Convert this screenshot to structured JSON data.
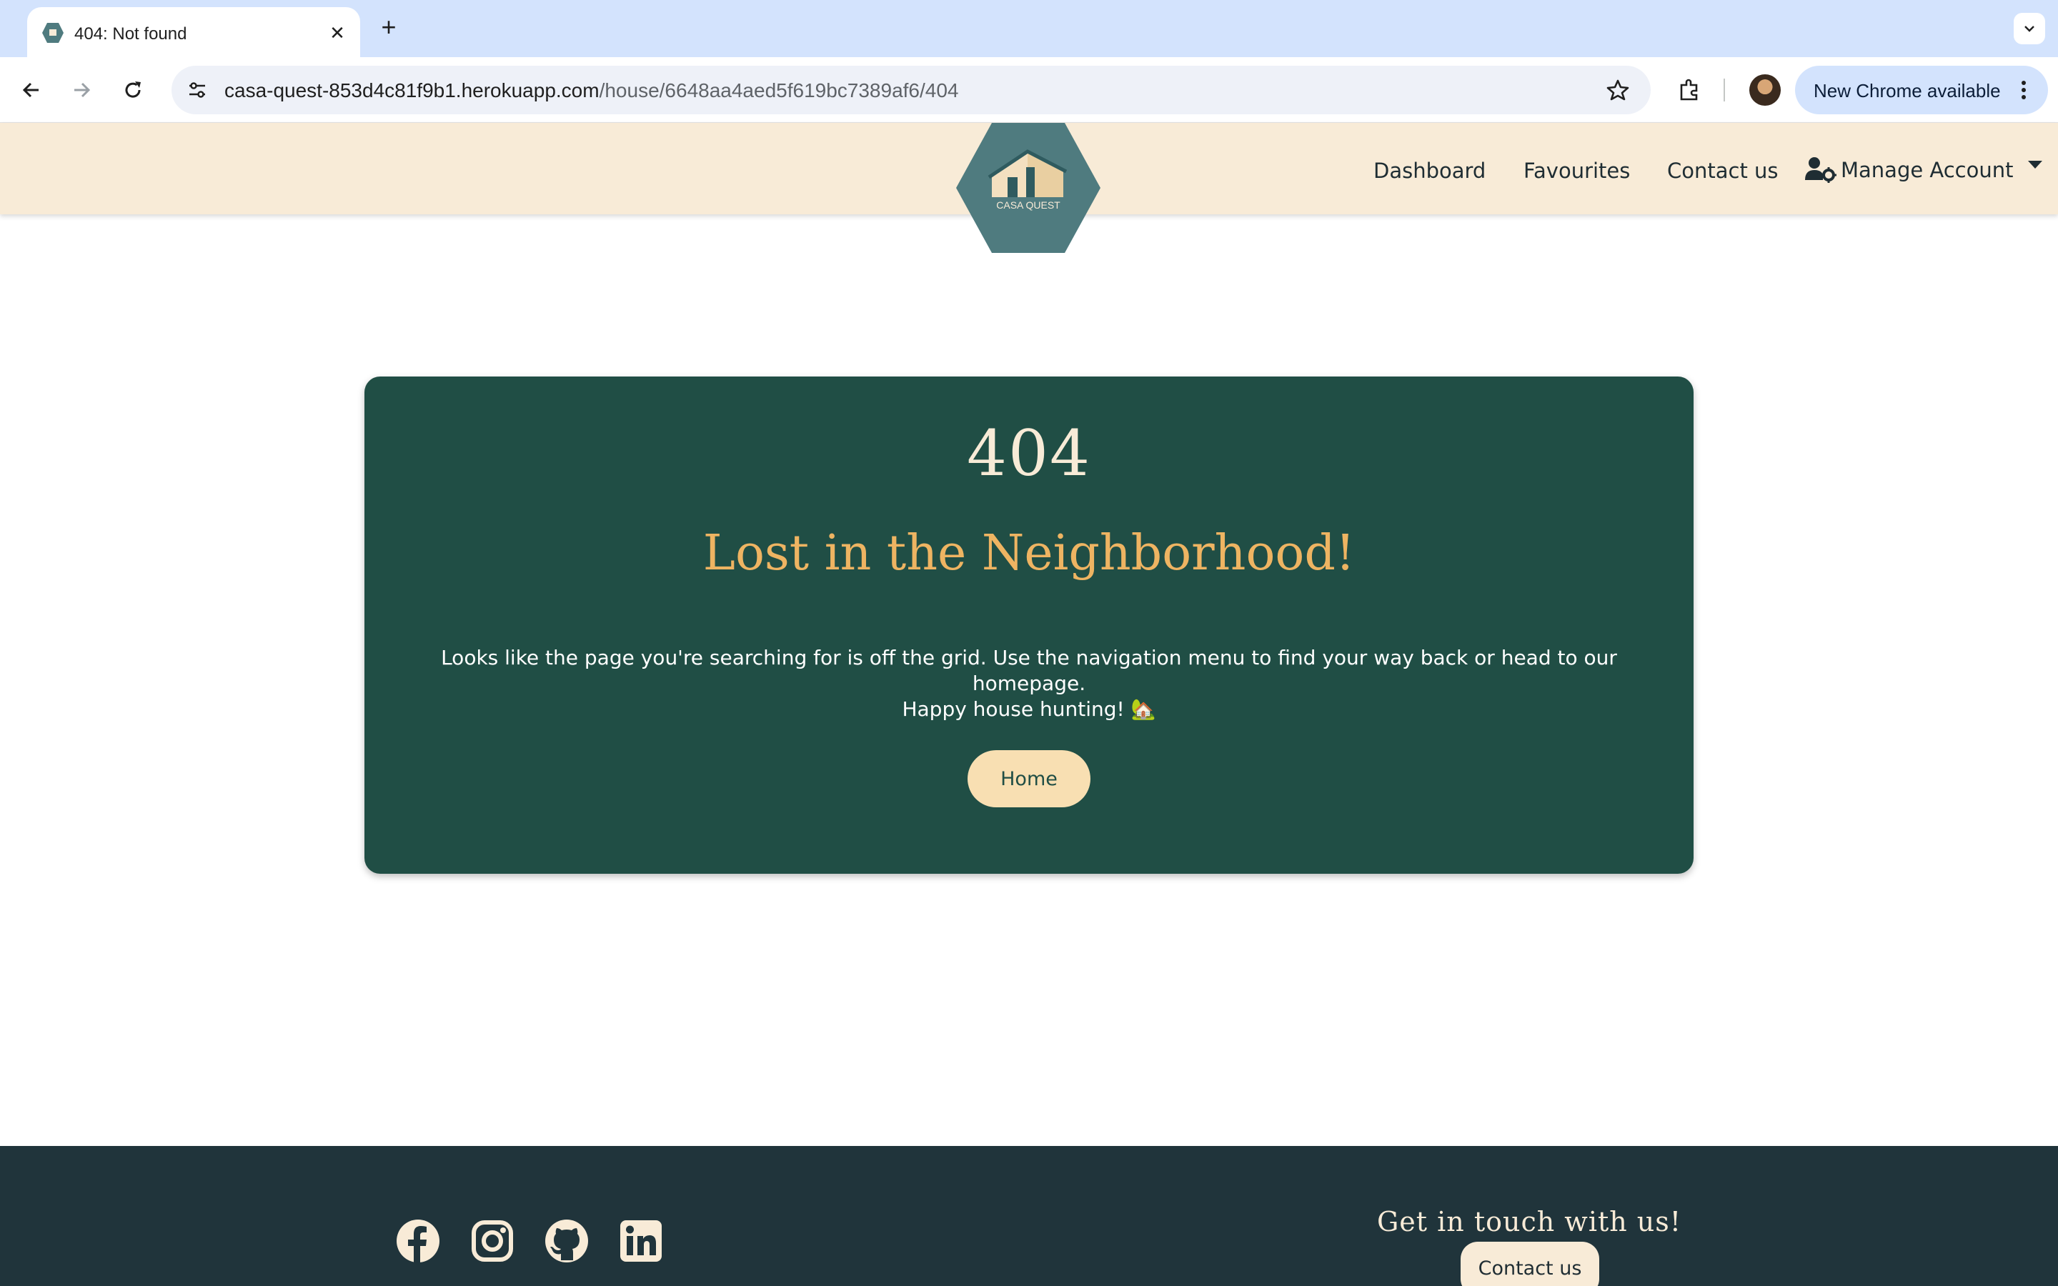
{
  "browser": {
    "tab_title": "404: Not found",
    "tab_close": "✕",
    "new_tab": "+",
    "url_host": "casa-quest-853d4c81f9b1.herokuapp.com",
    "url_path": "/house/6648aa4aed5f619bc7389af6/404",
    "update_label": "New Chrome available"
  },
  "site": {
    "logo_text": "CASA QUEST",
    "nav": {
      "dashboard": "Dashboard",
      "favourites": "Favourites",
      "contact": "Contact us",
      "manage_account": "Manage Account"
    }
  },
  "error": {
    "code": "404",
    "headline": "Lost in the Neighborhood!",
    "message_line1": "Looks like the page you're searching for is off the grid. Use the navigation menu to find your way back or head to our homepage.",
    "message_line2": "Happy house hunting! 🏡",
    "home_button": "Home"
  },
  "footer": {
    "social_icons": [
      "facebook-icon",
      "instagram-icon",
      "github-icon",
      "linkedin-icon"
    ],
    "touch_heading": "Get in touch with us!",
    "contact_button": "Contact us"
  },
  "colors": {
    "nav_bg": "#f8ebd7",
    "card_bg": "#204e45",
    "headline": "#eeb462",
    "footer_bg": "#20343b",
    "logo_bg": "#4f7b7f"
  }
}
